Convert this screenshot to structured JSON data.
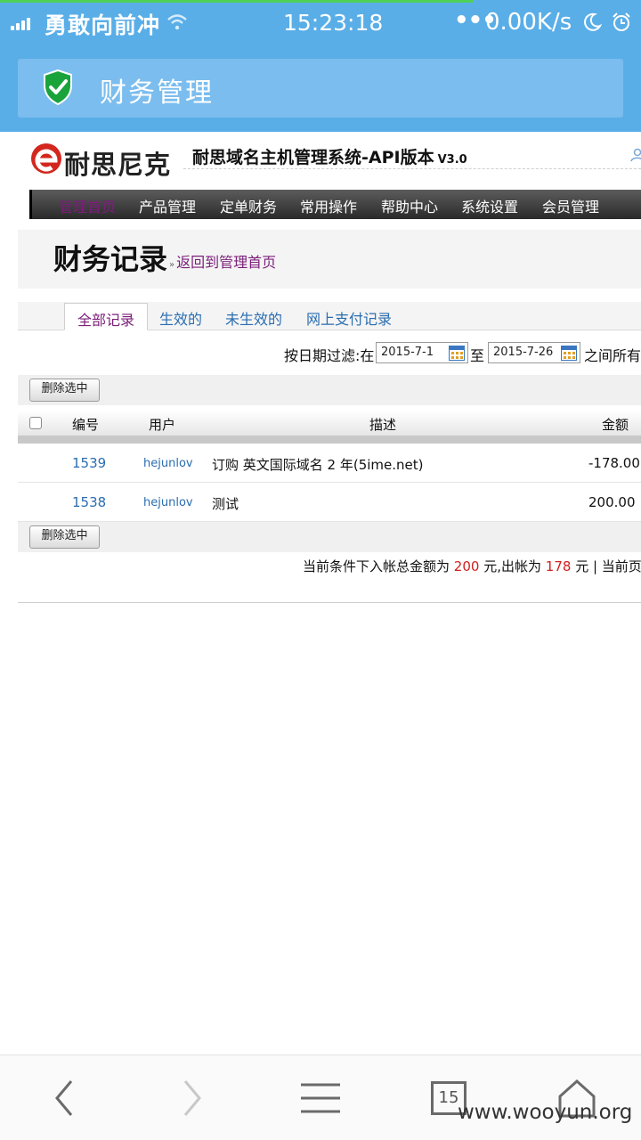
{
  "status_bar": {
    "carrier": "勇敢向前冲",
    "time": "15:23:18",
    "dots": "•••",
    "speed": "0.00K/s"
  },
  "app_bar": {
    "title": "财务管理"
  },
  "site": {
    "logo_text": "耐思尼克",
    "system_title": "耐思域名主机管理系统-API版本",
    "version": "V3.0"
  },
  "nav": {
    "items": [
      {
        "label": "管理首页",
        "active": true
      },
      {
        "label": "产品管理"
      },
      {
        "label": "定单财务"
      },
      {
        "label": "常用操作"
      },
      {
        "label": "帮助中心"
      },
      {
        "label": "系统设置"
      },
      {
        "label": "会员管理"
      }
    ]
  },
  "page": {
    "title": "财务记录",
    "back_link": "返回到管理首页"
  },
  "tabs": [
    {
      "label": "全部记录",
      "active": true
    },
    {
      "label": "生效的"
    },
    {
      "label": "未生效的"
    },
    {
      "label": "网上支付记录"
    }
  ],
  "filter": {
    "label": "按日期过滤:在",
    "start_date": "2015-7-1",
    "to_label": "至",
    "end_date": "2015-7-26",
    "between_label": "之间所有"
  },
  "actions": {
    "delete_selected": "删除选中"
  },
  "table": {
    "headers": {
      "id": "编号",
      "user": "用户",
      "desc": "描述",
      "amount": "金额"
    },
    "rows": [
      {
        "id": "1539",
        "user": "hejunlov",
        "desc": "订购 英文国际域名 2 年(5ime.net)",
        "amount": "-178.00"
      },
      {
        "id": "1538",
        "user": "hejunlov",
        "desc": "测试",
        "amount": "200.00"
      }
    ]
  },
  "summary": {
    "prefix": "当前条件下入帐总金额为",
    "income": "200",
    "mid": "元,出帐为",
    "outgo": "178",
    "suffix": "元 | 当前页"
  },
  "browser_bar": {
    "tab_count": "15"
  },
  "watermark": "www.wooyun.org",
  "colors": {
    "status_bg": "#5aaee7",
    "title_box": "#7bbdee",
    "accent_purple": "#7b1e7a",
    "link_blue": "#2a6db0",
    "red": "#d21f1f",
    "shield_green": "#1aa33b"
  }
}
